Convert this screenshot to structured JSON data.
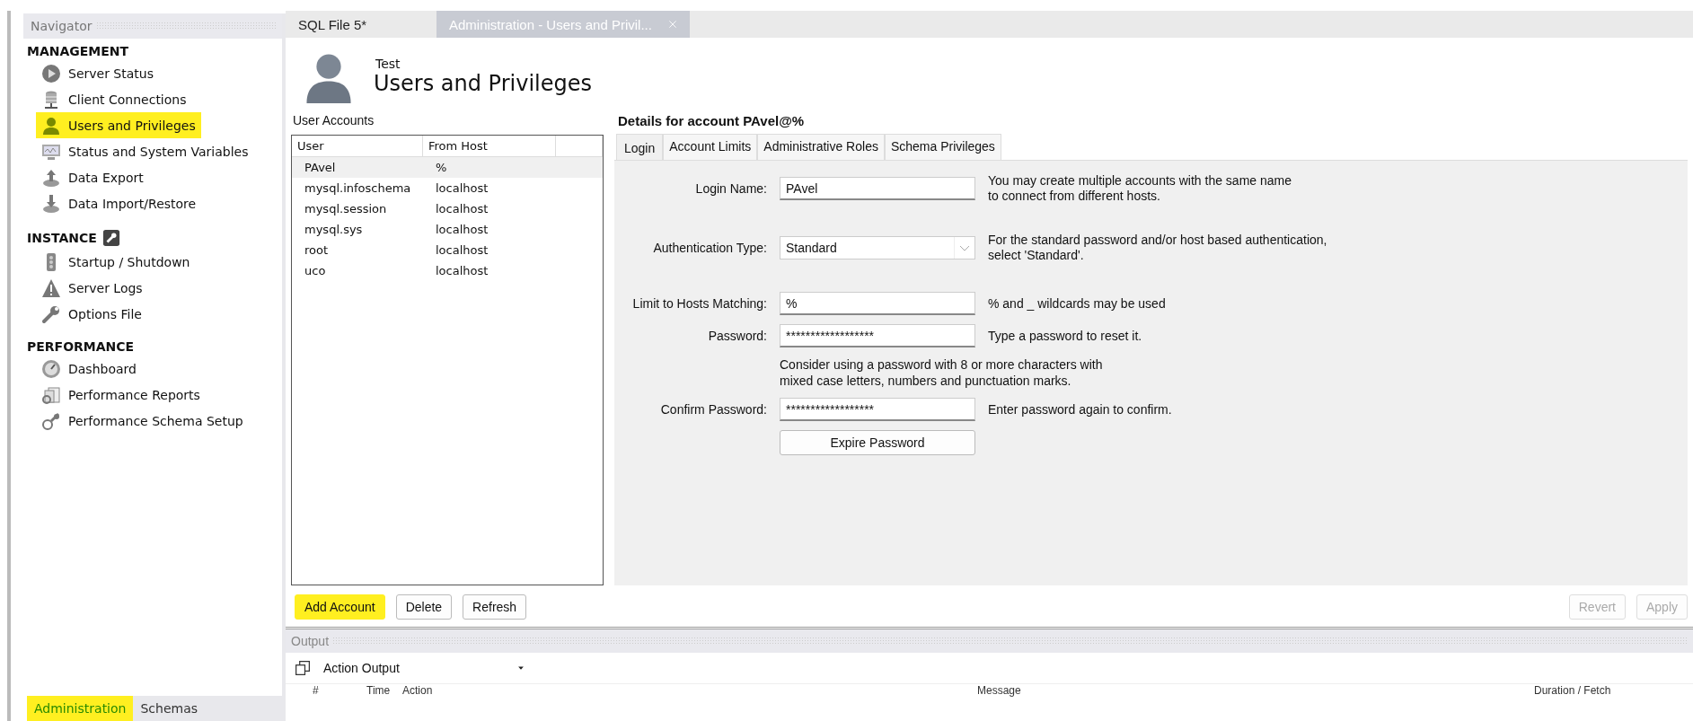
{
  "navigator": {
    "title": "Navigator",
    "sections": [
      {
        "heading": "MANAGEMENT",
        "items": [
          {
            "label": "Server Status",
            "highlighted": false
          },
          {
            "label": "Client Connections",
            "highlighted": false
          },
          {
            "label": "Users and Privileges",
            "highlighted": true
          },
          {
            "label": "Status and System Variables",
            "highlighted": false
          },
          {
            "label": "Data Export",
            "highlighted": false
          },
          {
            "label": "Data Import/Restore",
            "highlighted": false
          }
        ]
      },
      {
        "heading": "INSTANCE",
        "items": [
          {
            "label": "Startup / Shutdown",
            "highlighted": false
          },
          {
            "label": "Server Logs",
            "highlighted": false
          },
          {
            "label": "Options File",
            "highlighted": false
          }
        ]
      },
      {
        "heading": "PERFORMANCE",
        "items": [
          {
            "label": "Dashboard",
            "highlighted": false
          },
          {
            "label": "Performance Reports",
            "highlighted": false
          },
          {
            "label": "Performance Schema Setup",
            "highlighted": false
          }
        ]
      }
    ],
    "bottom_tabs": [
      {
        "label": "Administration",
        "selected": true,
        "highlighted": true
      },
      {
        "label": "Schemas",
        "selected": false,
        "highlighted": false
      }
    ]
  },
  "editor_tabs": [
    {
      "label": "SQL File 5*",
      "selected": false,
      "closable": false
    },
    {
      "label": "Administration - Users and Privil...",
      "selected": true,
      "closable": true
    }
  ],
  "header": {
    "subtitle": "Test",
    "title": "Users and Privileges"
  },
  "user_accounts": {
    "label": "User Accounts",
    "columns": [
      "User",
      "From Host"
    ],
    "rows": [
      {
        "user": "PAvel",
        "host": "%",
        "selected": true
      },
      {
        "user": "mysql.infoschema",
        "host": "localhost",
        "selected": false
      },
      {
        "user": "mysql.session",
        "host": "localhost",
        "selected": false
      },
      {
        "user": "mysql.sys",
        "host": "localhost",
        "selected": false
      },
      {
        "user": "root",
        "host": "localhost",
        "selected": false
      },
      {
        "user": "uco",
        "host": "localhost",
        "selected": false
      }
    ]
  },
  "details": {
    "title": "Details for account PAvel@%",
    "tabs": [
      {
        "label": "Login",
        "selected": true
      },
      {
        "label": "Account Limits",
        "selected": false
      },
      {
        "label": "Administrative Roles",
        "selected": false
      },
      {
        "label": "Schema Privileges",
        "selected": false
      }
    ],
    "fields": [
      {
        "kind": "text",
        "label": "Login Name:",
        "value": "PAvel",
        "hint": "You may create multiple accounts with the same name\nto connect from different hosts."
      },
      {
        "kind": "select",
        "label": "Authentication Type:",
        "value": "Standard",
        "hint": "For the standard password and/or host based authentication,\nselect 'Standard'."
      },
      {
        "kind": "text",
        "label": "Limit to Hosts Matching:",
        "value": "%",
        "hint": "% and _ wildcards may be used"
      },
      {
        "kind": "text",
        "label": "Password:",
        "value": "******************",
        "hint": "Type a password to reset it."
      },
      {
        "kind": "note",
        "text": "Consider using a password with 8 or more characters with\nmixed case letters, numbers and punctuation marks."
      },
      {
        "kind": "text",
        "label": "Confirm Password:",
        "value": "******************",
        "hint": "Enter password again to confirm."
      },
      {
        "kind": "button",
        "label": "Expire Password"
      }
    ]
  },
  "left_buttons": [
    {
      "label": "Add Account",
      "highlighted": true,
      "disabled": false
    },
    {
      "label": "Delete",
      "highlighted": false,
      "disabled": false
    },
    {
      "label": "Refresh",
      "highlighted": false,
      "disabled": false
    }
  ],
  "right_buttons": [
    {
      "label": "Revert",
      "highlighted": false,
      "disabled": true
    },
    {
      "label": "Apply",
      "highlighted": false,
      "disabled": true
    }
  ],
  "output": {
    "title": "Output",
    "selector": "Action Output",
    "columns": [
      "#",
      "Time",
      "Action",
      "Message",
      "Duration / Fetch"
    ]
  }
}
